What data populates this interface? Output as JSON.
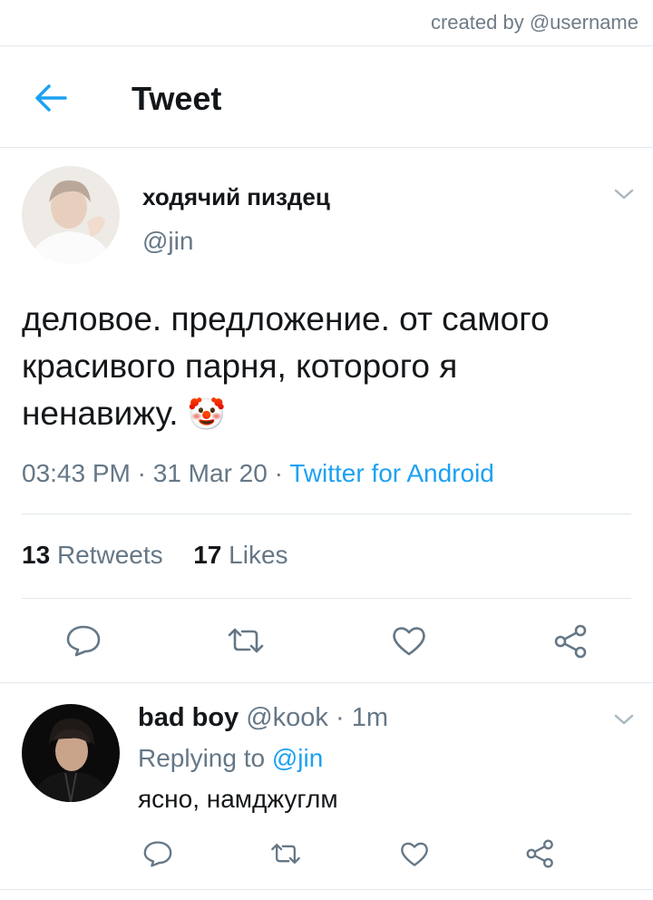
{
  "watermark": "created by @username",
  "header": {
    "title": "Tweet"
  },
  "tweet": {
    "author_name": "ходячий пиздец",
    "author_handle": "@jin",
    "text": "деловое. предложение. от самого красивого парня, которого я ненавижу.",
    "emoji": "🤡",
    "time": "03:43 PM",
    "date": "31 Mar 20",
    "sep": "·",
    "source": "Twitter for Android",
    "retweets_count": "13",
    "retweets_label": "Retweets",
    "likes_count": "17",
    "likes_label": "Likes"
  },
  "reply": {
    "author_name": "bad boy",
    "author_handle": "@kook",
    "sep": "·",
    "time": "1m",
    "replying_label": "Replying to",
    "replying_handle": "@jin",
    "text": "ясно, намджуглм"
  },
  "icons": {
    "back": "arrow-left-icon",
    "chevron": "chevron-down-icon",
    "reply": "reply-icon",
    "retweet": "retweet-icon",
    "like": "heart-icon",
    "share": "share-icon"
  },
  "colors": {
    "accent": "#1da1f2",
    "text": "#14171a",
    "muted": "#657786",
    "divider": "#e1e8ed"
  }
}
